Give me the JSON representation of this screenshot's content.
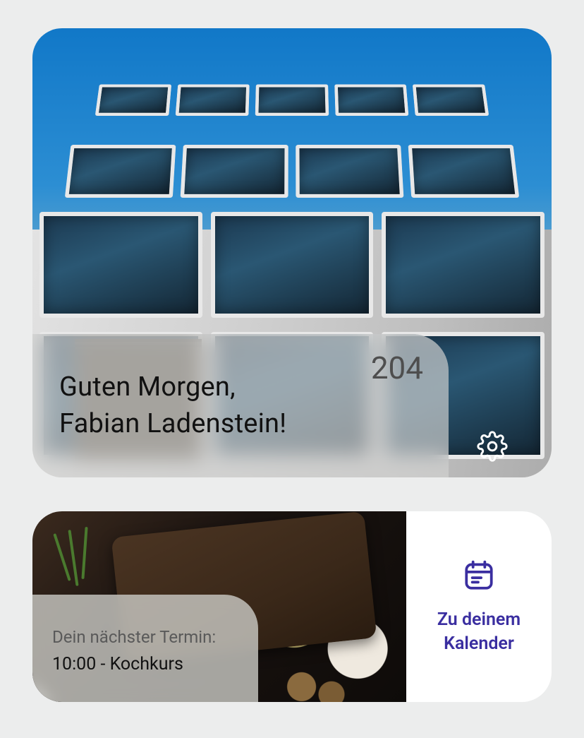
{
  "colors": {
    "accent": "#3a2ea0",
    "background": "#eceded",
    "panel_glass": "rgba(210,210,208,0.68)"
  },
  "hero": {
    "greeting_line1": "Guten Morgen,",
    "greeting_line2": "Fabian Ladenstein!",
    "room_number": "204",
    "settings_icon": "gear-icon"
  },
  "appointment": {
    "label": "Dein nächster Termin:",
    "time": "10:00",
    "title": "Kochkurs",
    "display": "10:00 - Kochkurs"
  },
  "calendar_link": {
    "icon": "calendar-icon",
    "text_line1": "Zu deinem",
    "text_line2": "Kalender"
  }
}
